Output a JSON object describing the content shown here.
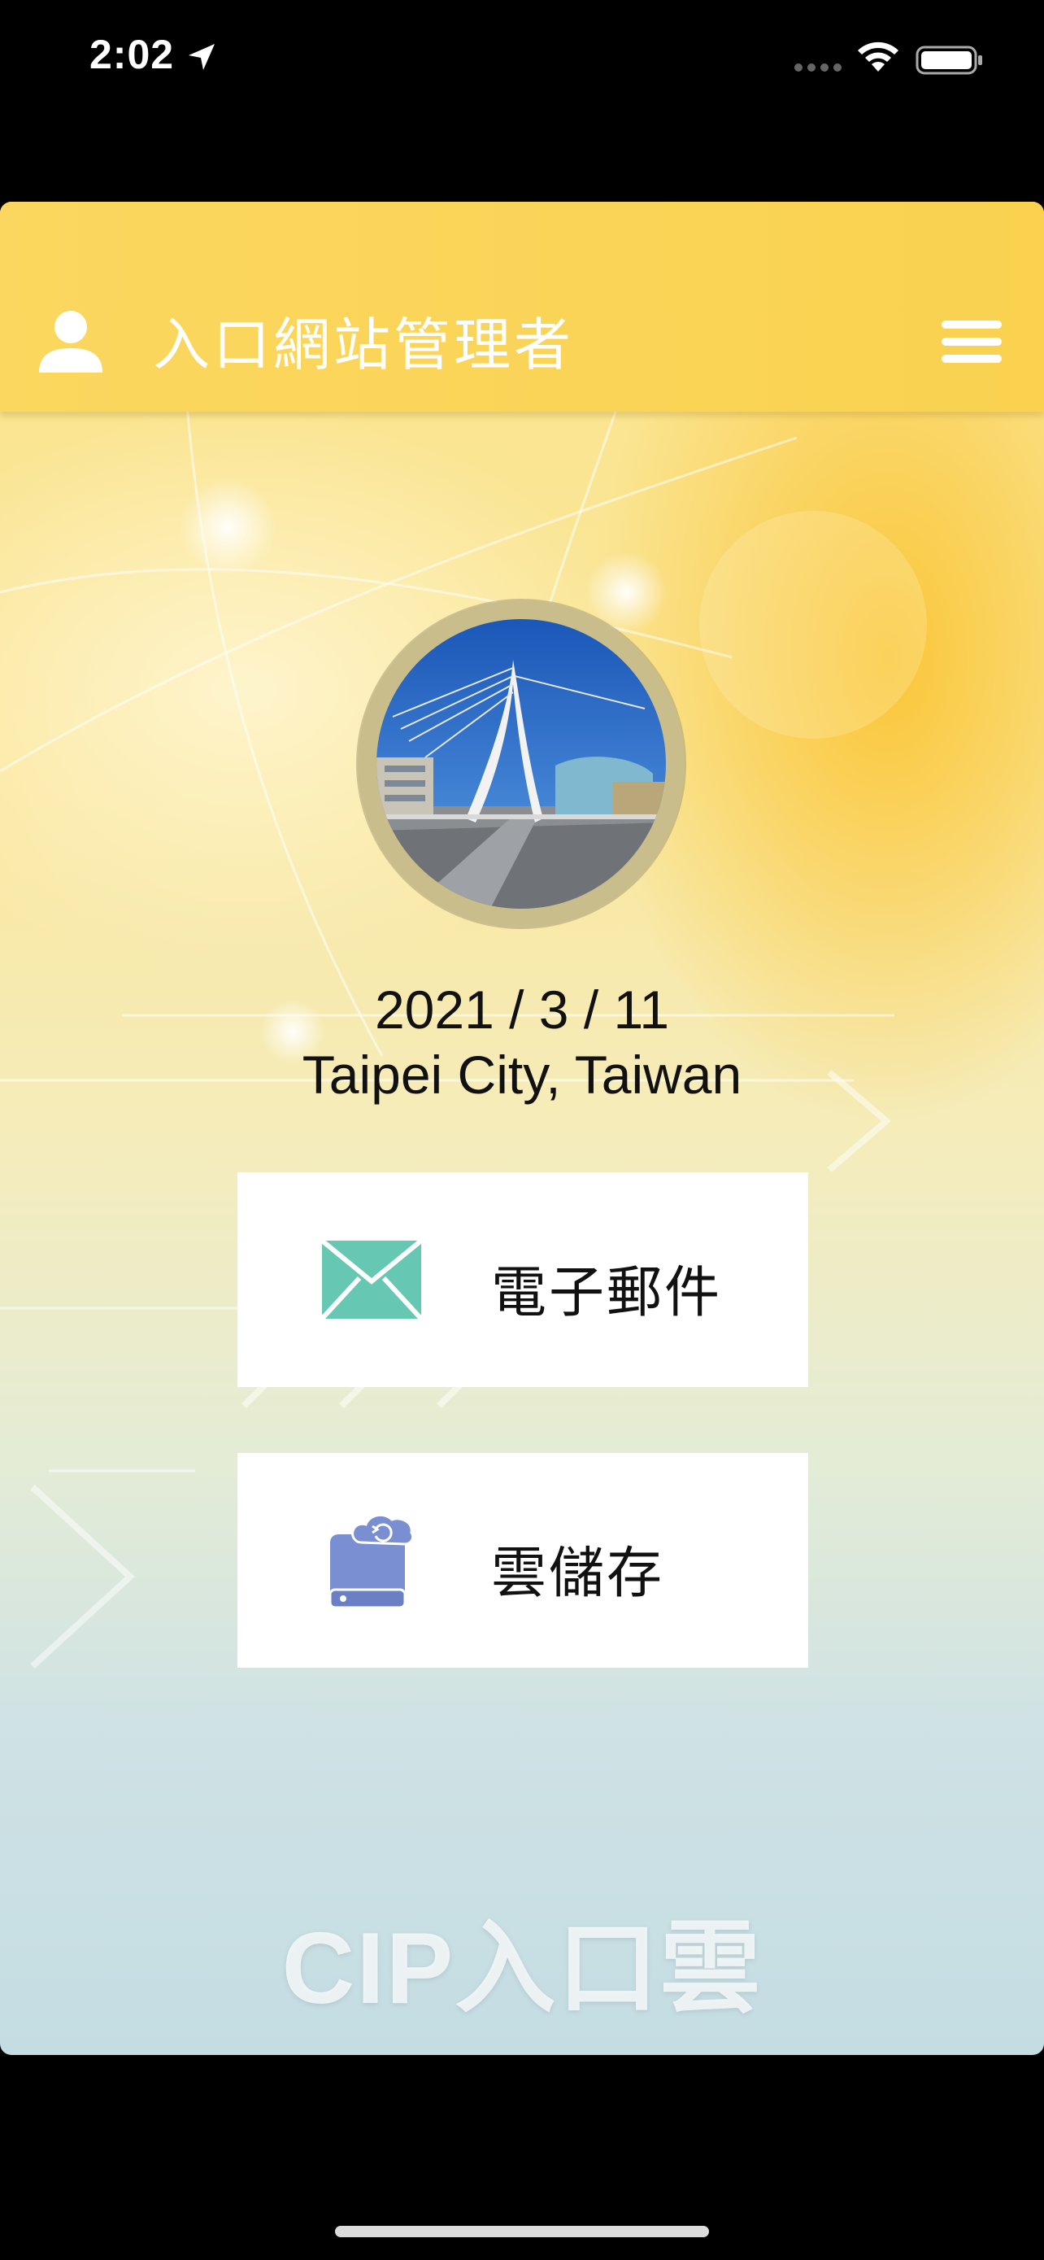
{
  "status_bar": {
    "time": "2:02"
  },
  "header": {
    "title": "入口網站管理者"
  },
  "profile": {
    "date": "2021 / 3 / 11",
    "location": "Taipei City, Taiwan"
  },
  "tiles": [
    {
      "label": "電子郵件",
      "icon": "mail-icon",
      "color": "#66c7b3"
    },
    {
      "label": "雲儲存",
      "icon": "cloud-storage-icon",
      "color": "#7a8fd1"
    }
  ],
  "brand": {
    "text": "CIP入口雲"
  },
  "colors": {
    "header": "#fad250",
    "tile_bg": "#ffffff"
  }
}
